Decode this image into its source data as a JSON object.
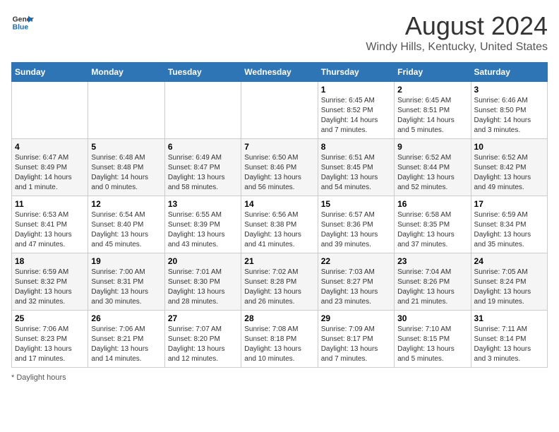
{
  "header": {
    "logo_line1": "General",
    "logo_line2": "Blue",
    "main_title": "August 2024",
    "subtitle": "Windy Hills, Kentucky, United States"
  },
  "calendar": {
    "days_of_week": [
      "Sunday",
      "Monday",
      "Tuesday",
      "Wednesday",
      "Thursday",
      "Friday",
      "Saturday"
    ],
    "weeks": [
      [
        {
          "day": "",
          "info": ""
        },
        {
          "day": "",
          "info": ""
        },
        {
          "day": "",
          "info": ""
        },
        {
          "day": "",
          "info": ""
        },
        {
          "day": "1",
          "info": "Sunrise: 6:45 AM\nSunset: 8:52 PM\nDaylight: 14 hours and 7 minutes."
        },
        {
          "day": "2",
          "info": "Sunrise: 6:45 AM\nSunset: 8:51 PM\nDaylight: 14 hours and 5 minutes."
        },
        {
          "day": "3",
          "info": "Sunrise: 6:46 AM\nSunset: 8:50 PM\nDaylight: 14 hours and 3 minutes."
        }
      ],
      [
        {
          "day": "4",
          "info": "Sunrise: 6:47 AM\nSunset: 8:49 PM\nDaylight: 14 hours and 1 minute."
        },
        {
          "day": "5",
          "info": "Sunrise: 6:48 AM\nSunset: 8:48 PM\nDaylight: 14 hours and 0 minutes."
        },
        {
          "day": "6",
          "info": "Sunrise: 6:49 AM\nSunset: 8:47 PM\nDaylight: 13 hours and 58 minutes."
        },
        {
          "day": "7",
          "info": "Sunrise: 6:50 AM\nSunset: 8:46 PM\nDaylight: 13 hours and 56 minutes."
        },
        {
          "day": "8",
          "info": "Sunrise: 6:51 AM\nSunset: 8:45 PM\nDaylight: 13 hours and 54 minutes."
        },
        {
          "day": "9",
          "info": "Sunrise: 6:52 AM\nSunset: 8:44 PM\nDaylight: 13 hours and 52 minutes."
        },
        {
          "day": "10",
          "info": "Sunrise: 6:52 AM\nSunset: 8:42 PM\nDaylight: 13 hours and 49 minutes."
        }
      ],
      [
        {
          "day": "11",
          "info": "Sunrise: 6:53 AM\nSunset: 8:41 PM\nDaylight: 13 hours and 47 minutes."
        },
        {
          "day": "12",
          "info": "Sunrise: 6:54 AM\nSunset: 8:40 PM\nDaylight: 13 hours and 45 minutes."
        },
        {
          "day": "13",
          "info": "Sunrise: 6:55 AM\nSunset: 8:39 PM\nDaylight: 13 hours and 43 minutes."
        },
        {
          "day": "14",
          "info": "Sunrise: 6:56 AM\nSunset: 8:38 PM\nDaylight: 13 hours and 41 minutes."
        },
        {
          "day": "15",
          "info": "Sunrise: 6:57 AM\nSunset: 8:36 PM\nDaylight: 13 hours and 39 minutes."
        },
        {
          "day": "16",
          "info": "Sunrise: 6:58 AM\nSunset: 8:35 PM\nDaylight: 13 hours and 37 minutes."
        },
        {
          "day": "17",
          "info": "Sunrise: 6:59 AM\nSunset: 8:34 PM\nDaylight: 13 hours and 35 minutes."
        }
      ],
      [
        {
          "day": "18",
          "info": "Sunrise: 6:59 AM\nSunset: 8:32 PM\nDaylight: 13 hours and 32 minutes."
        },
        {
          "day": "19",
          "info": "Sunrise: 7:00 AM\nSunset: 8:31 PM\nDaylight: 13 hours and 30 minutes."
        },
        {
          "day": "20",
          "info": "Sunrise: 7:01 AM\nSunset: 8:30 PM\nDaylight: 13 hours and 28 minutes."
        },
        {
          "day": "21",
          "info": "Sunrise: 7:02 AM\nSunset: 8:28 PM\nDaylight: 13 hours and 26 minutes."
        },
        {
          "day": "22",
          "info": "Sunrise: 7:03 AM\nSunset: 8:27 PM\nDaylight: 13 hours and 23 minutes."
        },
        {
          "day": "23",
          "info": "Sunrise: 7:04 AM\nSunset: 8:26 PM\nDaylight: 13 hours and 21 minutes."
        },
        {
          "day": "24",
          "info": "Sunrise: 7:05 AM\nSunset: 8:24 PM\nDaylight: 13 hours and 19 minutes."
        }
      ],
      [
        {
          "day": "25",
          "info": "Sunrise: 7:06 AM\nSunset: 8:23 PM\nDaylight: 13 hours and 17 minutes."
        },
        {
          "day": "26",
          "info": "Sunrise: 7:06 AM\nSunset: 8:21 PM\nDaylight: 13 hours and 14 minutes."
        },
        {
          "day": "27",
          "info": "Sunrise: 7:07 AM\nSunset: 8:20 PM\nDaylight: 13 hours and 12 minutes."
        },
        {
          "day": "28",
          "info": "Sunrise: 7:08 AM\nSunset: 8:18 PM\nDaylight: 13 hours and 10 minutes."
        },
        {
          "day": "29",
          "info": "Sunrise: 7:09 AM\nSunset: 8:17 PM\nDaylight: 13 hours and 7 minutes."
        },
        {
          "day": "30",
          "info": "Sunrise: 7:10 AM\nSunset: 8:15 PM\nDaylight: 13 hours and 5 minutes."
        },
        {
          "day": "31",
          "info": "Sunrise: 7:11 AM\nSunset: 8:14 PM\nDaylight: 13 hours and 3 minutes."
        }
      ]
    ]
  },
  "footer": {
    "note": "Daylight hours"
  }
}
